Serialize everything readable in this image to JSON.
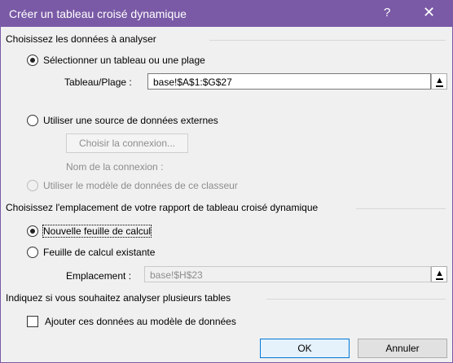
{
  "window": {
    "title": "Créer un tableau croisé dynamique",
    "help_glyph": "?",
    "close_glyph": "✕"
  },
  "section1": {
    "heading": "Choisissez les données à analyser",
    "radio_table": "Sélectionner un tableau ou une plage",
    "range_label": "Tableau/Plage :",
    "range_value": "base!$A$1:$G$27",
    "radio_external": "Utiliser une source de données externes",
    "connection_button": "Choisir la connexion...",
    "connection_name_label": "Nom de la connexion :",
    "radio_model": "Utiliser le modèle de données de ce classeur"
  },
  "section2": {
    "heading": "Choisissez l'emplacement de votre rapport de tableau croisé dynamique",
    "radio_new_sheet": "Nouvelle feuille de calcul",
    "radio_existing_sheet": "Feuille de calcul existante",
    "location_label": "Emplacement :",
    "location_value": "base!$H$23"
  },
  "section3": {
    "heading": "Indiquez si vous souhaitez analyser plusieurs tables",
    "checkbox_label": "Ajouter ces données au modèle de données"
  },
  "buttons": {
    "ok": "OK",
    "cancel": "Annuler"
  },
  "colors": {
    "titlebar": "#7a5aa6",
    "background": "#f0f0f0",
    "ok_border": "#0078d7"
  },
  "icons": {
    "upload": "collapse-dialog-icon"
  }
}
